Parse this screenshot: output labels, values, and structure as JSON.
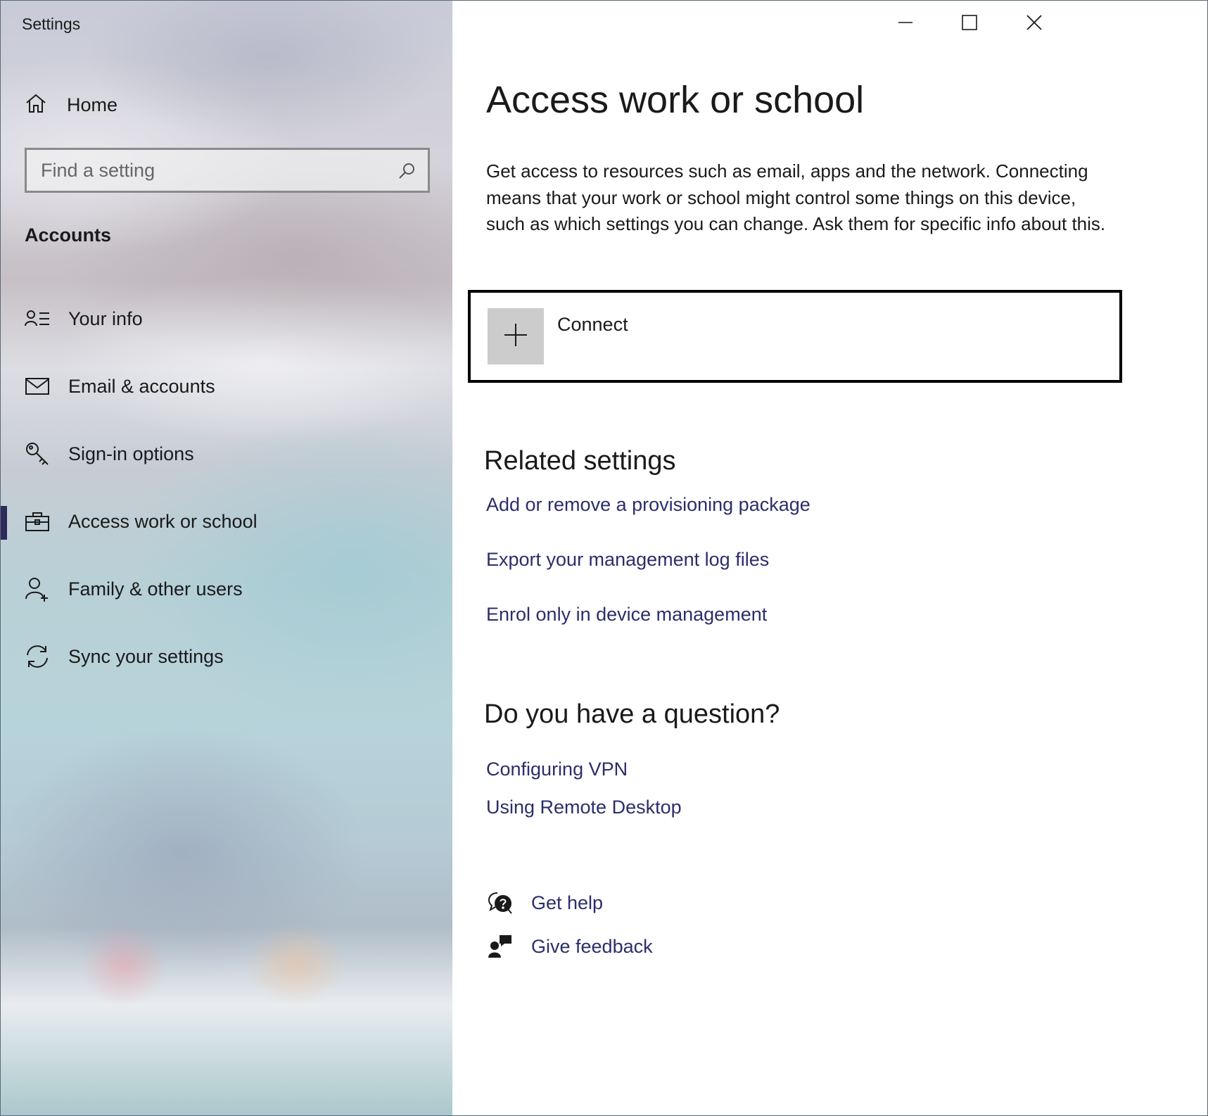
{
  "window": {
    "title": "Settings",
    "controls": {
      "minimize": "minimize",
      "maximize": "maximize",
      "close": "close"
    }
  },
  "sidebar": {
    "home_label": "Home",
    "search_placeholder": "Find a setting",
    "section_label": "Accounts",
    "items": [
      {
        "label": "Your info",
        "icon": "person-list-icon",
        "active": false
      },
      {
        "label": "Email & accounts",
        "icon": "mail-icon",
        "active": false
      },
      {
        "label": "Sign-in options",
        "icon": "key-icon",
        "active": false
      },
      {
        "label": "Access work or school",
        "icon": "briefcase-icon",
        "active": true
      },
      {
        "label": "Family & other users",
        "icon": "add-person-icon",
        "active": false
      },
      {
        "label": "Sync your settings",
        "icon": "sync-icon",
        "active": false
      }
    ],
    "active_indicator_color": "#2e2a5a"
  },
  "main": {
    "title": "Access work or school",
    "intro": "Get access to resources such as email, apps and the network. Connecting means that your work or school might control some things on this device, such as which settings you can change. Ask them for specific info about this.",
    "connect_label": "Connect",
    "related_heading": "Related settings",
    "related_links": [
      "Add or remove a provisioning package",
      "Export your management log files",
      "Enrol only in device management"
    ],
    "question_heading": "Do you have a question?",
    "question_links": [
      "Configuring VPN",
      "Using Remote Desktop"
    ],
    "help": {
      "get_help": "Get help",
      "give_feedback": "Give feedback"
    },
    "link_color": "#2b2e6b"
  }
}
